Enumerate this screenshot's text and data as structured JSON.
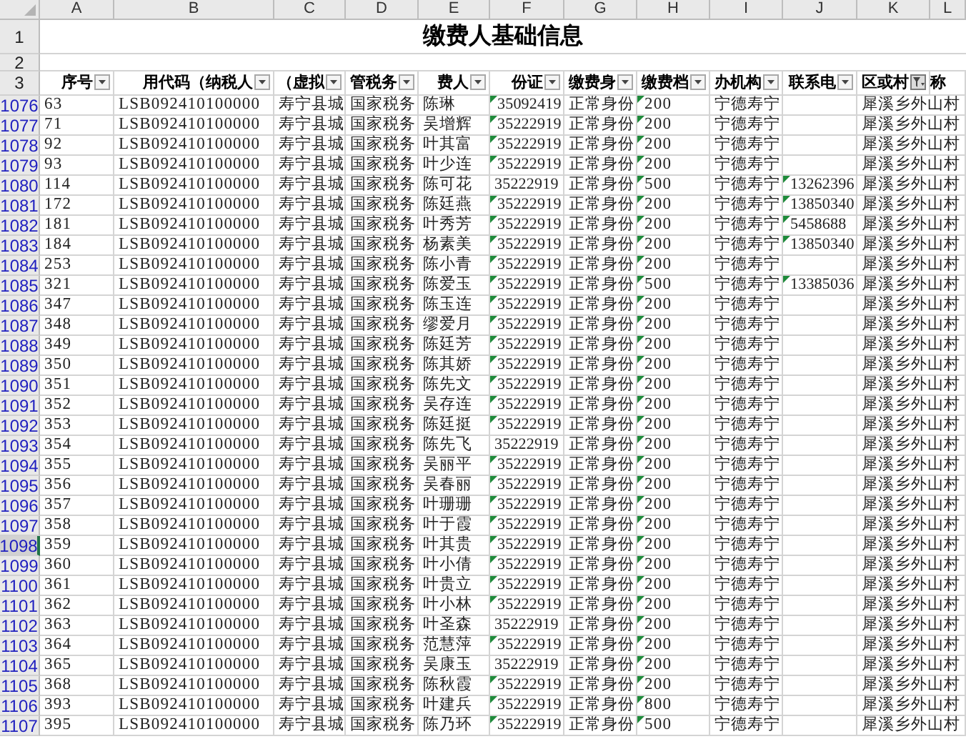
{
  "columns": [
    "A",
    "B",
    "C",
    "D",
    "E",
    "F",
    "G",
    "H",
    "I",
    "J",
    "K",
    "L"
  ],
  "title_row": {
    "number": "1",
    "title": "缴费人基础信息"
  },
  "blank_row": {
    "number": "2"
  },
  "header_row": {
    "number": "3",
    "headers": [
      {
        "label": "序号",
        "filter_active": false
      },
      {
        "label": "用代码（纳税人",
        "filter_active": false
      },
      {
        "label": "（虚拟",
        "filter_active": false
      },
      {
        "label": "管税务",
        "filter_active": false
      },
      {
        "label": "费人",
        "filter_active": false
      },
      {
        "label": "份证",
        "filter_active": false
      },
      {
        "label": "缴费身",
        "filter_active": false
      },
      {
        "label": "缴费档",
        "filter_active": false
      },
      {
        "label": "办机构",
        "filter_active": false
      },
      {
        "label": "联系电",
        "filter_active": false
      },
      {
        "label": "区或村",
        "filter_active": true
      },
      {
        "label": "称"
      }
    ]
  },
  "rows": [
    {
      "number": "1076",
      "selected": false,
      "id_flag": true,
      "cells": [
        "63",
        "LSB092410100000",
        "寿宁县城",
        "国家税务",
        "陈琳",
        "35092419",
        "正常身份",
        "200",
        "宁德寿宁",
        "",
        "犀溪乡外山村"
      ]
    },
    {
      "number": "1077",
      "selected": false,
      "id_flag": true,
      "cells": [
        "71",
        "LSB092410100000",
        "寿宁县城",
        "国家税务",
        "吴增辉",
        "35222919",
        "正常身份",
        "200",
        "宁德寿宁",
        "",
        "犀溪乡外山村"
      ]
    },
    {
      "number": "1078",
      "selected": false,
      "id_flag": true,
      "cells": [
        "92",
        "LSB092410100000",
        "寿宁县城",
        "国家税务",
        "叶其富",
        "35222919",
        "正常身份",
        "200",
        "宁德寿宁",
        "",
        "犀溪乡外山村"
      ]
    },
    {
      "number": "1079",
      "selected": false,
      "id_flag": true,
      "cells": [
        "93",
        "LSB092410100000",
        "寿宁县城",
        "国家税务",
        "叶少连",
        "35222919",
        "正常身份",
        "200",
        "宁德寿宁",
        "",
        "犀溪乡外山村"
      ]
    },
    {
      "number": "1080",
      "selected": false,
      "id_flag": false,
      "cells": [
        "114",
        "LSB092410100000",
        "寿宁县城",
        "国家税务",
        "陈可花",
        "35222919",
        "正常身份",
        "500",
        "宁德寿宁",
        "13262396",
        "犀溪乡外山村"
      ]
    },
    {
      "number": "1081",
      "selected": false,
      "id_flag": true,
      "cells": [
        "172",
        "LSB092410100000",
        "寿宁县城",
        "国家税务",
        "陈廷燕",
        "35222919",
        "正常身份",
        "200",
        "宁德寿宁",
        "13850340",
        "犀溪乡外山村"
      ]
    },
    {
      "number": "1082",
      "selected": false,
      "id_flag": true,
      "cells": [
        "181",
        "LSB092410100000",
        "寿宁县城",
        "国家税务",
        "叶秀芳",
        "35222919",
        "正常身份",
        "200",
        "宁德寿宁",
        "5458688",
        "犀溪乡外山村"
      ]
    },
    {
      "number": "1083",
      "selected": false,
      "id_flag": true,
      "cells": [
        "184",
        "LSB092410100000",
        "寿宁县城",
        "国家税务",
        "杨素美",
        "35222919",
        "正常身份",
        "200",
        "宁德寿宁",
        "13850340",
        "犀溪乡外山村"
      ]
    },
    {
      "number": "1084",
      "selected": false,
      "id_flag": true,
      "cells": [
        "253",
        "LSB092410100000",
        "寿宁县城",
        "国家税务",
        "陈小青",
        "35222919",
        "正常身份",
        "200",
        "宁德寿宁",
        "",
        "犀溪乡外山村"
      ]
    },
    {
      "number": "1085",
      "selected": false,
      "id_flag": true,
      "cells": [
        "321",
        "LSB092410100000",
        "寿宁县城",
        "国家税务",
        "陈爱玉",
        "35222919",
        "正常身份",
        "500",
        "宁德寿宁",
        "13385036",
        "犀溪乡外山村"
      ]
    },
    {
      "number": "1086",
      "selected": false,
      "id_flag": true,
      "cells": [
        "347",
        "LSB092410100000",
        "寿宁县城",
        "国家税务",
        "陈玉连",
        "35222919",
        "正常身份",
        "200",
        "宁德寿宁",
        "",
        "犀溪乡外山村"
      ]
    },
    {
      "number": "1087",
      "selected": false,
      "id_flag": true,
      "cells": [
        "348",
        "LSB092410100000",
        "寿宁县城",
        "国家税务",
        "缪爱月",
        "35222919",
        "正常身份",
        "200",
        "宁德寿宁",
        "",
        "犀溪乡外山村"
      ]
    },
    {
      "number": "1088",
      "selected": false,
      "id_flag": true,
      "cells": [
        "349",
        "LSB092410100000",
        "寿宁县城",
        "国家税务",
        "陈廷芳",
        "35222919",
        "正常身份",
        "200",
        "宁德寿宁",
        "",
        "犀溪乡外山村"
      ]
    },
    {
      "number": "1089",
      "selected": false,
      "id_flag": true,
      "cells": [
        "350",
        "LSB092410100000",
        "寿宁县城",
        "国家税务",
        "陈其娇",
        "35222919",
        "正常身份",
        "200",
        "宁德寿宁",
        "",
        "犀溪乡外山村"
      ]
    },
    {
      "number": "1090",
      "selected": false,
      "id_flag": true,
      "cells": [
        "351",
        "LSB092410100000",
        "寿宁县城",
        "国家税务",
        "陈先文",
        "35222919",
        "正常身份",
        "200",
        "宁德寿宁",
        "",
        "犀溪乡外山村"
      ]
    },
    {
      "number": "1091",
      "selected": false,
      "id_flag": true,
      "cells": [
        "352",
        "LSB092410100000",
        "寿宁县城",
        "国家税务",
        "吴存连",
        "35222919",
        "正常身份",
        "200",
        "宁德寿宁",
        "",
        "犀溪乡外山村"
      ]
    },
    {
      "number": "1092",
      "selected": false,
      "id_flag": true,
      "cells": [
        "353",
        "LSB092410100000",
        "寿宁县城",
        "国家税务",
        "陈廷挺",
        "35222919",
        "正常身份",
        "200",
        "宁德寿宁",
        "",
        "犀溪乡外山村"
      ]
    },
    {
      "number": "1093",
      "selected": false,
      "id_flag": false,
      "cells": [
        "354",
        "LSB092410100000",
        "寿宁县城",
        "国家税务",
        "陈先飞",
        "35222919",
        "正常身份",
        "200",
        "宁德寿宁",
        "",
        "犀溪乡外山村"
      ]
    },
    {
      "number": "1094",
      "selected": false,
      "id_flag": true,
      "cells": [
        "355",
        "LSB092410100000",
        "寿宁县城",
        "国家税务",
        "吴丽平",
        "35222919",
        "正常身份",
        "200",
        "宁德寿宁",
        "",
        "犀溪乡外山村"
      ]
    },
    {
      "number": "1095",
      "selected": false,
      "id_flag": true,
      "cells": [
        "356",
        "LSB092410100000",
        "寿宁县城",
        "国家税务",
        "吴春丽",
        "35222919",
        "正常身份",
        "200",
        "宁德寿宁",
        "",
        "犀溪乡外山村"
      ]
    },
    {
      "number": "1096",
      "selected": false,
      "id_flag": true,
      "cells": [
        "357",
        "LSB092410100000",
        "寿宁县城",
        "国家税务",
        "叶珊珊",
        "35222919",
        "正常身份",
        "200",
        "宁德寿宁",
        "",
        "犀溪乡外山村"
      ]
    },
    {
      "number": "1097",
      "selected": false,
      "id_flag": true,
      "cells": [
        "358",
        "LSB092410100000",
        "寿宁县城",
        "国家税务",
        "叶于霞",
        "35222919",
        "正常身份",
        "200",
        "宁德寿宁",
        "",
        "犀溪乡外山村"
      ]
    },
    {
      "number": "1098",
      "selected": true,
      "id_flag": true,
      "cells": [
        "359",
        "LSB092410100000",
        "寿宁县城",
        "国家税务",
        "叶其贵",
        "35222919",
        "正常身份",
        "200",
        "宁德寿宁",
        "",
        "犀溪乡外山村"
      ]
    },
    {
      "number": "1099",
      "selected": false,
      "id_flag": true,
      "cells": [
        "360",
        "LSB092410100000",
        "寿宁县城",
        "国家税务",
        "叶小倩",
        "35222919",
        "正常身份",
        "200",
        "宁德寿宁",
        "",
        "犀溪乡外山村"
      ]
    },
    {
      "number": "1100",
      "selected": false,
      "id_flag": true,
      "cells": [
        "361",
        "LSB092410100000",
        "寿宁县城",
        "国家税务",
        "叶贵立",
        "35222919",
        "正常身份",
        "200",
        "宁德寿宁",
        "",
        "犀溪乡外山村"
      ]
    },
    {
      "number": "1101",
      "selected": false,
      "id_flag": true,
      "cells": [
        "362",
        "LSB092410100000",
        "寿宁县城",
        "国家税务",
        "叶小林",
        "35222919",
        "正常身份",
        "200",
        "宁德寿宁",
        "",
        "犀溪乡外山村"
      ]
    },
    {
      "number": "1102",
      "selected": false,
      "id_flag": false,
      "cells": [
        "363",
        "LSB092410100000",
        "寿宁县城",
        "国家税务",
        "叶圣森",
        "35222919",
        "正常身份",
        "200",
        "宁德寿宁",
        "",
        "犀溪乡外山村"
      ]
    },
    {
      "number": "1103",
      "selected": false,
      "id_flag": true,
      "cells": [
        "364",
        "LSB092410100000",
        "寿宁县城",
        "国家税务",
        "范慧萍",
        "35222919",
        "正常身份",
        "200",
        "宁德寿宁",
        "",
        "犀溪乡外山村"
      ]
    },
    {
      "number": "1104",
      "selected": false,
      "id_flag": false,
      "cells": [
        "365",
        "LSB092410100000",
        "寿宁县城",
        "国家税务",
        "吴康玉",
        "35222919",
        "正常身份",
        "200",
        "宁德寿宁",
        "",
        "犀溪乡外山村"
      ]
    },
    {
      "number": "1105",
      "selected": false,
      "id_flag": true,
      "cells": [
        "368",
        "LSB092410100000",
        "寿宁县城",
        "国家税务",
        "陈秋霞",
        "35222919",
        "正常身份",
        "200",
        "宁德寿宁",
        "",
        "犀溪乡外山村"
      ]
    },
    {
      "number": "1106",
      "selected": false,
      "id_flag": true,
      "cells": [
        "393",
        "LSB092410100000",
        "寿宁县城",
        "国家税务",
        "叶建兵",
        "35222919",
        "正常身份",
        "800",
        "宁德寿宁",
        "",
        "犀溪乡外山村"
      ]
    },
    {
      "number": "1107",
      "selected": false,
      "id_flag": true,
      "cells": [
        "395",
        "LSB092410100000",
        "寿宁县城",
        "国家税务",
        "陈乃环",
        "35222919",
        "正常身份",
        "500",
        "宁德寿宁",
        "",
        "犀溪乡外山村"
      ]
    }
  ]
}
